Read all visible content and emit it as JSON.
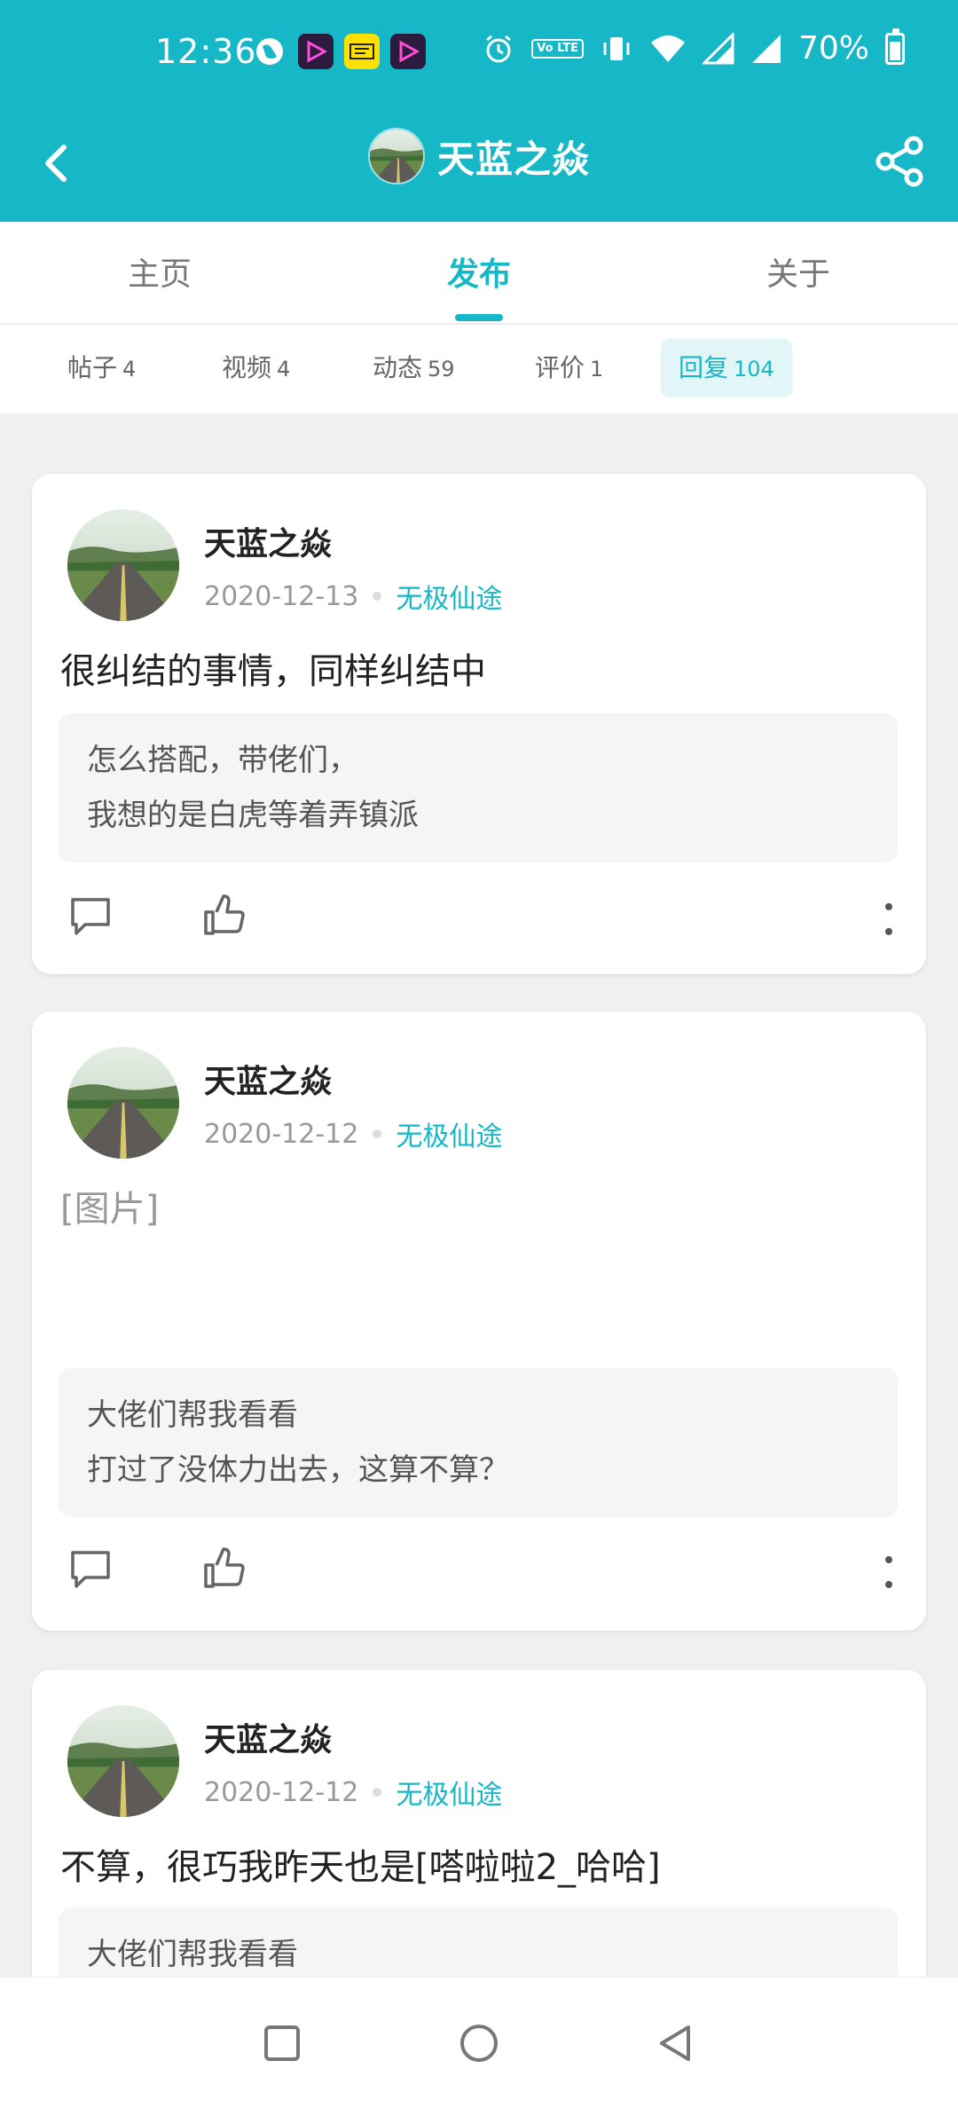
{
  "status_bar": {
    "time": "12:36",
    "battery": "70%",
    "left_icons": [
      "globe-icon",
      "video-app-icon",
      "yellow-app-icon",
      "video-app-icon"
    ],
    "right_icons": [
      "alarm-icon",
      "volte-icon",
      "vibrate-icon",
      "wifi-icon",
      "signal-icon",
      "signal-icon",
      "battery-icon"
    ],
    "volte_label": "Vo LTE"
  },
  "header": {
    "title": "天蓝之焱",
    "accent_color": "#16b7c6"
  },
  "tabs": [
    {
      "label": "主页",
      "active": false
    },
    {
      "label": "发布",
      "active": true
    },
    {
      "label": "关于",
      "active": false
    }
  ],
  "subtabs": [
    {
      "label": "帖子",
      "count": "4",
      "active": false
    },
    {
      "label": "视频",
      "count": "4",
      "active": false
    },
    {
      "label": "动态",
      "count": "59",
      "active": false
    },
    {
      "label": "评价",
      "count": "1",
      "active": false
    },
    {
      "label": "回复",
      "count": "104",
      "active": true
    }
  ],
  "posts": [
    {
      "author": "天蓝之焱",
      "date": "2020-12-13",
      "game": "无极仙途",
      "reply": "很纠结的事情，同样纠结中",
      "quote_lines": [
        "怎么搭配，带佬们，",
        "我想的是白虎等着弄镇派"
      ]
    },
    {
      "author": "天蓝之焱",
      "date": "2020-12-12",
      "game": "无极仙途",
      "reply": "[图片]",
      "quote_lines": [
        "大佬们帮我看看",
        "打过了没体力出去，这算不算？"
      ]
    },
    {
      "author": "天蓝之焱",
      "date": "2020-12-12",
      "game": "无极仙途",
      "reply": "不算，很巧我昨天也是[嗒啦啦2_哈哈]",
      "quote_lines": [
        "大佬们帮我看看"
      ]
    }
  ]
}
